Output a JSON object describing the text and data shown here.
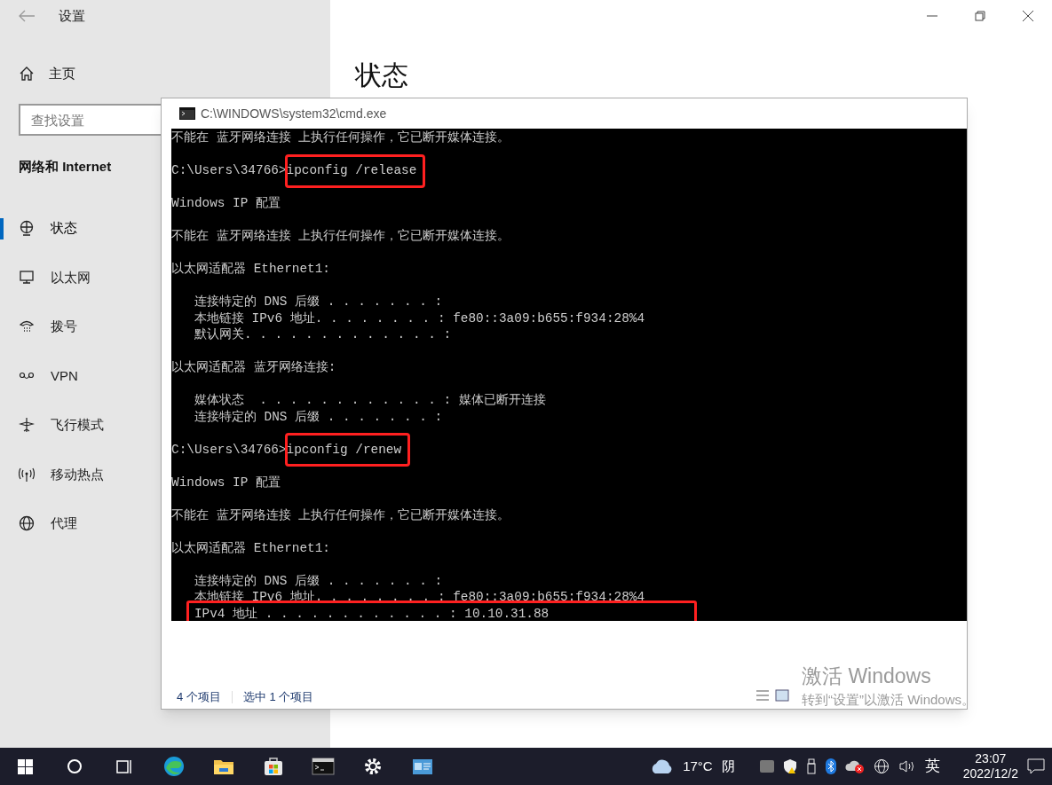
{
  "settings": {
    "title": "设置",
    "home": "主页",
    "search": {
      "placeholder": "查找设置"
    },
    "section": "网络和 Internet",
    "items": [
      {
        "label": "状态",
        "selected": true
      },
      {
        "label": "以太网",
        "selected": false
      },
      {
        "label": "拨号",
        "selected": false
      },
      {
        "label": "VPN",
        "selected": false
      },
      {
        "label": "飞行模式",
        "selected": false
      },
      {
        "label": "移动热点",
        "selected": false
      },
      {
        "label": "代理",
        "selected": false
      }
    ],
    "page_title": "状态"
  },
  "cmd": {
    "title": "C:\\WINDOWS\\system32\\cmd.exe",
    "blocks": [
      [
        {
          "kind": "output",
          "text": "不能在 蓝牙网络连接 上执行任何操作，它已断开媒体连接。",
          "highlighted": false
        }
      ],
      [
        {
          "kind": "prompt",
          "prompt": "C:\\Users\\34766>",
          "command": "ipconfig /release",
          "highlighted": true
        }
      ],
      [
        {
          "kind": "output",
          "text": "Windows IP 配置",
          "highlighted": false
        }
      ],
      [
        {
          "kind": "output",
          "text": "不能在 蓝牙网络连接 上执行任何操作，它已断开媒体连接。",
          "highlighted": false
        }
      ],
      [
        {
          "kind": "output",
          "text": "以太网适配器 Ethernet1:",
          "highlighted": false
        }
      ],
      [
        {
          "kind": "output",
          "text": "   连接特定的 DNS 后缀 . . . . . . . :",
          "highlighted": false
        },
        {
          "kind": "output",
          "text": "   本地链接 IPv6 地址. . . . . . . . : fe80::3a09:b655:f934:28%4",
          "highlighted": false
        },
        {
          "kind": "output",
          "text": "   默认网关. . . . . . . . . . . . . :",
          "highlighted": false
        }
      ],
      [
        {
          "kind": "output",
          "text": "以太网适配器 蓝牙网络连接:",
          "highlighted": false
        }
      ],
      [
        {
          "kind": "output",
          "text": "   媒体状态  . . . . . . . . . . . . : 媒体已断开连接",
          "highlighted": false
        },
        {
          "kind": "output",
          "text": "   连接特定的 DNS 后缀 . . . . . . . :",
          "highlighted": false
        }
      ],
      [
        {
          "kind": "prompt",
          "prompt": "C:\\Users\\34766>",
          "command": "ipconfig /renew",
          "highlighted": true
        }
      ],
      [
        {
          "kind": "output",
          "text": "Windows IP 配置",
          "highlighted": false
        }
      ],
      [
        {
          "kind": "output",
          "text": "不能在 蓝牙网络连接 上执行任何操作，它已断开媒体连接。",
          "highlighted": false
        }
      ],
      [
        {
          "kind": "output",
          "text": "以太网适配器 Ethernet1:",
          "highlighted": false
        }
      ],
      [
        {
          "kind": "output",
          "text": "   连接特定的 DNS 后缀 . . . . . . . :",
          "highlighted": false
        },
        {
          "kind": "output",
          "text": "   本地链接 IPv6 地址. . . . . . . . : fe80::3a09:b655:f934:28%4",
          "highlighted": false
        },
        {
          "kind": "output",
          "text": "   IPv4 地址 . . . . . . . . . . . . : 10.10.31.88",
          "highlighted": true
        }
      ]
    ]
  },
  "explorer_status": [
    "4 个项目",
    "选中 1 个项目"
  ],
  "activation": {
    "title": "激活 Windows",
    "hint": "转到“设置”以激活 Windows。"
  },
  "taskbar": {
    "weather": {
      "temp": "17°C",
      "condition": "阴"
    },
    "ime": "英",
    "time": "23:07",
    "date": "2022/12/2"
  }
}
